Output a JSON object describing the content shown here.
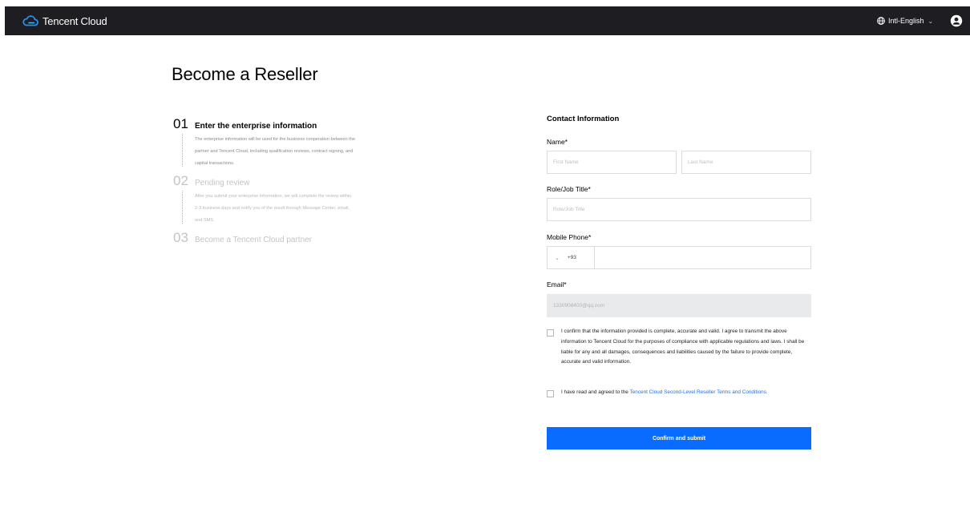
{
  "topbar": {
    "brand": "Tencent Cloud",
    "language": "Intl-English",
    "colors": {
      "background": "#1d1d22",
      "logo_blue": "#2d8cf0"
    }
  },
  "page": {
    "title": "Become a Reseller"
  },
  "steps": [
    {
      "number": "01",
      "title": "Enter the enterprise information",
      "description": "The enterprise information will be used for the business cooperation between the partner and Tencent Cloud, including qualification reviews, contract signing, and capital transactions.",
      "active": true
    },
    {
      "number": "02",
      "title": "Pending review",
      "description": "After you submit your enterprise information, we will complete the review within 2-3 business days and notify you of the result through Message Center, email, and SMS.",
      "active": false
    },
    {
      "number": "03",
      "title": "Become a Tencent Cloud partner",
      "description": "",
      "active": false
    }
  ],
  "form": {
    "section_title": "Contact Information",
    "name_label": "Name*",
    "first_name_placeholder": "First Name",
    "last_name_placeholder": "Last Name",
    "role_label": "Role/Job Title*",
    "role_placeholder": "Role/Job Title",
    "phone_label": "Mobile Phone*",
    "phone_code": "+93",
    "phone_value": "",
    "email_label": "Email*",
    "email_value": "1330908400@qq.com",
    "confirm_text": "I confirm that the information provided is complete, accurate and valid. I agree to transmit the above information to Tencent Cloud for the purposes of compliance with applicable regulations and laws. I shall be liable for any and all damages, consequences and liabilities caused by the failure to provide complete, accurate and valid information.",
    "agree_prefix": "I have read and agreed to the ",
    "agree_link": "Tencent Cloud Second-Level Reseller Terms and Conditions",
    "agree_suffix": ".",
    "submit_label": "Confirm and submit",
    "colors": {
      "primary": "#0a6cff",
      "link": "#1f6fe5"
    }
  }
}
